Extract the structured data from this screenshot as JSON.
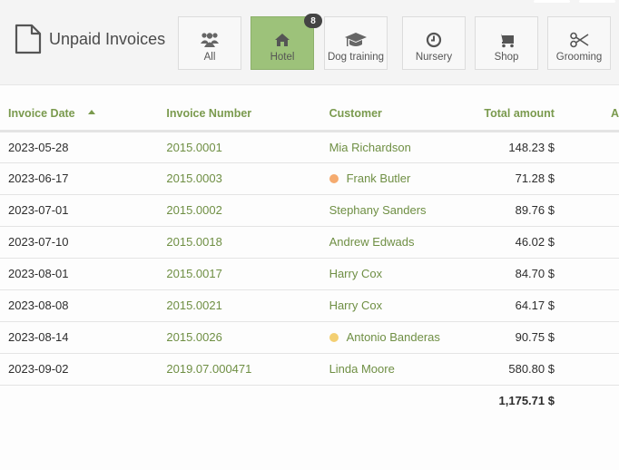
{
  "header": {
    "title": "Unpaid Invoices",
    "page_icon": "document-icon"
  },
  "filters": [
    {
      "label": "All",
      "icon": "users-icon",
      "active": false
    },
    {
      "label": "Hotel",
      "icon": "home-icon",
      "active": true,
      "badge": "8"
    },
    {
      "label": "Dog training",
      "icon": "graduation-cap-icon",
      "active": false
    },
    {
      "label": "Nursery",
      "icon": "clock-icon",
      "active": false
    },
    {
      "label": "Shop",
      "icon": "cart-icon",
      "active": false
    },
    {
      "label": "Grooming",
      "icon": "scissors-icon",
      "active": false
    }
  ],
  "table": {
    "columns": [
      "Invoice Date",
      "Invoice Number",
      "Customer",
      "Total amount",
      "A"
    ],
    "sort": {
      "column": "Invoice Date",
      "direction": "ascending"
    },
    "rows": [
      {
        "date": "2023-05-28",
        "number": "2015.0001",
        "customer": "Mia Richardson",
        "dot": null,
        "amount": "148.23 $"
      },
      {
        "date": "2023-06-17",
        "number": "2015.0003",
        "customer": "Frank Butler",
        "dot": "#f5ab6f",
        "amount": "71.28 $"
      },
      {
        "date": "2023-07-01",
        "number": "2015.0002",
        "customer": "Stephany Sanders",
        "dot": null,
        "amount": "89.76 $"
      },
      {
        "date": "2023-07-10",
        "number": "2015.0018",
        "customer": "Andrew Edwads",
        "dot": null,
        "amount": "46.02 $"
      },
      {
        "date": "2023-08-01",
        "number": "2015.0017",
        "customer": "Harry Cox",
        "dot": null,
        "amount": "84.70 $"
      },
      {
        "date": "2023-08-08",
        "number": "2015.0021",
        "customer": "Harry Cox",
        "dot": null,
        "amount": "64.17 $"
      },
      {
        "date": "2023-08-14",
        "number": "2015.0026",
        "customer": "Antonio Banderas",
        "dot": "#f3cf72",
        "amount": "90.75 $"
      },
      {
        "date": "2023-09-02",
        "number": "2019.07.000471",
        "customer": "Linda Moore",
        "dot": null,
        "amount": "580.80 $"
      }
    ],
    "total": "1,175.71 $"
  },
  "colors": {
    "accent": "#7a9a4e",
    "active_filter": "#9dc27a"
  }
}
